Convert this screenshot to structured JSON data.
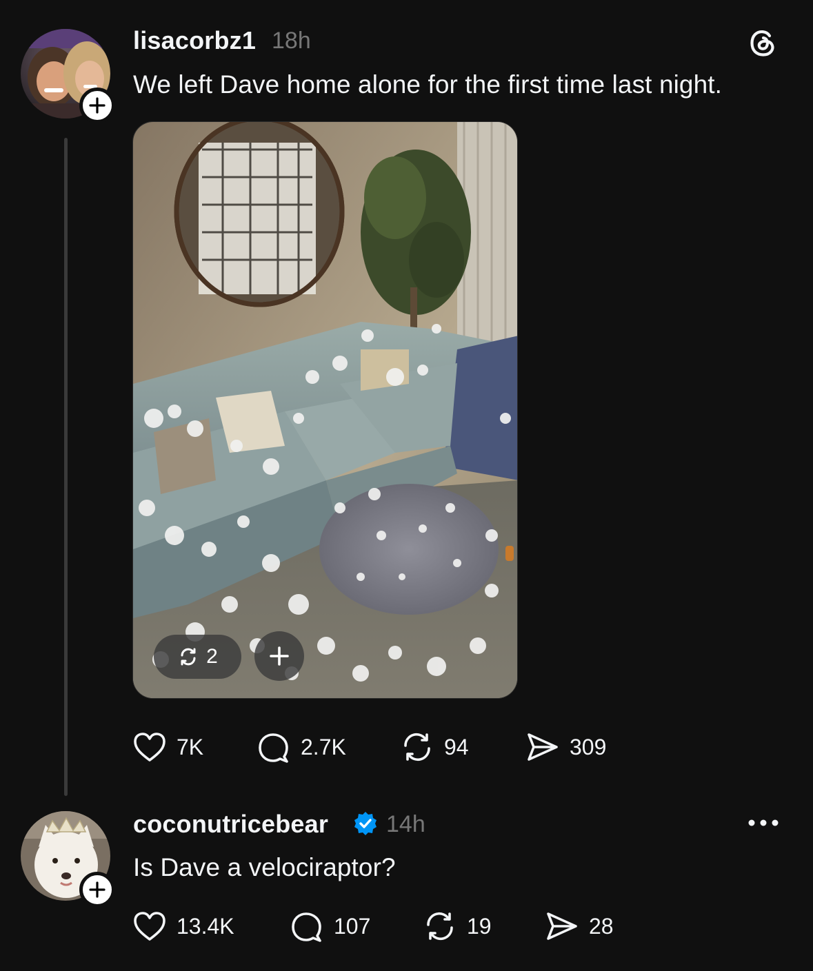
{
  "app": {
    "logo_icon": "threads-logo-icon"
  },
  "post": {
    "username": "lisacorbz1",
    "time": "18h",
    "text": "We left Dave home alone for the first time last night.",
    "media": {
      "repost_count": "2",
      "repost_icon": "repost-icon",
      "add_icon": "plus-icon"
    },
    "actions": {
      "likes": "7K",
      "comments": "2.7K",
      "reposts": "94",
      "shares": "309"
    }
  },
  "reply": {
    "username": "coconutricebear",
    "verified": true,
    "time": "14h",
    "text": "Is Dave a velociraptor?",
    "more_icon": "more-options-icon",
    "actions": {
      "likes": "13.4K",
      "comments": "107",
      "reposts": "19",
      "shares": "28"
    }
  },
  "colors": {
    "background": "#101010",
    "text": "#f3f5f7",
    "secondary_text": "#777777",
    "verified_badge": "#0095f6"
  }
}
